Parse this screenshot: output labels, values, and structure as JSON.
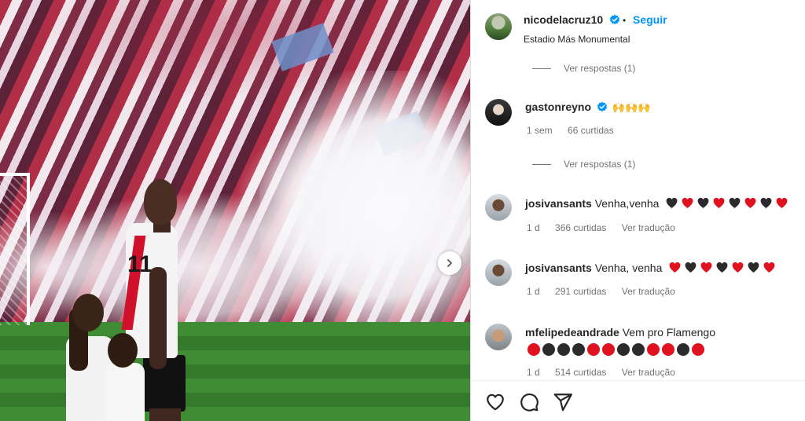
{
  "post": {
    "owner": "nicodelacruz10",
    "follow_label": "Seguir",
    "separator": "•",
    "location": "Estadio Más Monumental"
  },
  "comments": [
    {
      "kind": "replies",
      "label": "Ver respostas (1)"
    },
    {
      "kind": "comment",
      "user": "gastonreyno",
      "verified": true,
      "text": "",
      "emoji": "🙌🙌🙌",
      "time": "1 sem",
      "likes": "66 curtidas",
      "translate": ""
    },
    {
      "kind": "replies",
      "label": "Ver respostas (1)"
    },
    {
      "kind": "comment",
      "user": "josivansants",
      "verified": false,
      "text": "Venha,venha",
      "hearts": [
        "black",
        "red",
        "black",
        "red",
        "black",
        "red",
        "black",
        "red"
      ],
      "time": "1 d",
      "likes": "366 curtidas",
      "translate": "Ver tradução"
    },
    {
      "kind": "comment",
      "user": "josivansants",
      "verified": false,
      "text": "Venha, venha",
      "hearts": [
        "red",
        "black",
        "red",
        "black",
        "red",
        "black",
        "red"
      ],
      "time": "1 d",
      "likes": "291 curtidas",
      "translate": "Ver tradução"
    },
    {
      "kind": "comment",
      "user": "mfelipedeandrade",
      "verified": false,
      "text": "Vem pro Flamengo",
      "circles": [
        "red",
        "black",
        "black",
        "black",
        "red",
        "red",
        "black",
        "black",
        "red",
        "red",
        "black",
        "red"
      ],
      "time": "1 d",
      "likes": "514 curtidas",
      "translate": "Ver tradução"
    }
  ],
  "actions": {
    "like": "heart-icon",
    "comment": "comment-icon",
    "share": "share-icon"
  },
  "colors": {
    "link": "#0095f6",
    "meta": "#737373",
    "text": "#262626",
    "red_heart": "#e0121f",
    "black_heart": "#2b2b2b"
  }
}
